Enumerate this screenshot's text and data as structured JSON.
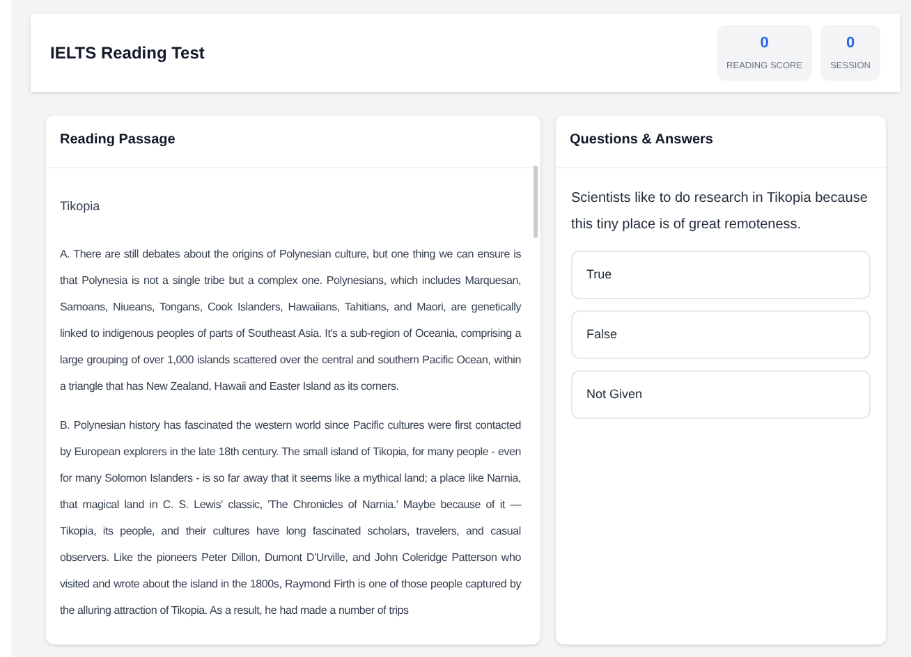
{
  "header": {
    "title": "IELTS Reading Test",
    "stats": [
      {
        "value": "0",
        "label": "READING SCORE"
      },
      {
        "value": "0",
        "label": "SESSION"
      }
    ]
  },
  "passage": {
    "heading": "Reading Passage",
    "title": "Tikopia",
    "paragraphs": [
      "A. There are still debates about the origins of Polynesian culture, but one thing we can ensure is that Polynesia is not a single tribe but a complex one. Polynesians, which includes Marquesan, Samoans, Niueans, Tongans, Cook Islanders, Hawaiians, Tahitians, and Maori, are genetically linked to indigenous peoples of parts of Southeast Asia. It's a sub-region of Oceania, comprising a large grouping of over 1,000 islands scattered over the central and southern Pacific Ocean, within a triangle that has New Zealand, Hawaii and Easter Island as its corners.",
      "B. Polynesian history has fascinated the western world since Pacific cultures were first contacted by European explorers in the late 18th century. The small island of Tikopia, for many people - even for many Solomon Islanders - is so far away that it seems like a mythical land; a place like Narnia, that magical land in C. S. Lewis' classic, 'The Chronicles of Narnia.' Maybe because of it — Tikopia, its people, and their cultures have long fascinated scholars, travelers, and casual observers. Like the pioneers Peter Dillon, Dumont D'Urville, and John Coleridge Patterson who visited and wrote about the island in the 1800s, Raymond Firth is one of those people captured by the alluring attraction of Tikopia. As a result, he had made a number of trips"
    ]
  },
  "questions": {
    "heading": "Questions & Answers",
    "question": "Scientists like to do research in Tikopia because this tiny place is of great remoteness.",
    "options": [
      {
        "label": "True",
        "selected": false
      },
      {
        "label": "False",
        "selected": false
      },
      {
        "label": "Not Given",
        "selected": false
      }
    ]
  }
}
